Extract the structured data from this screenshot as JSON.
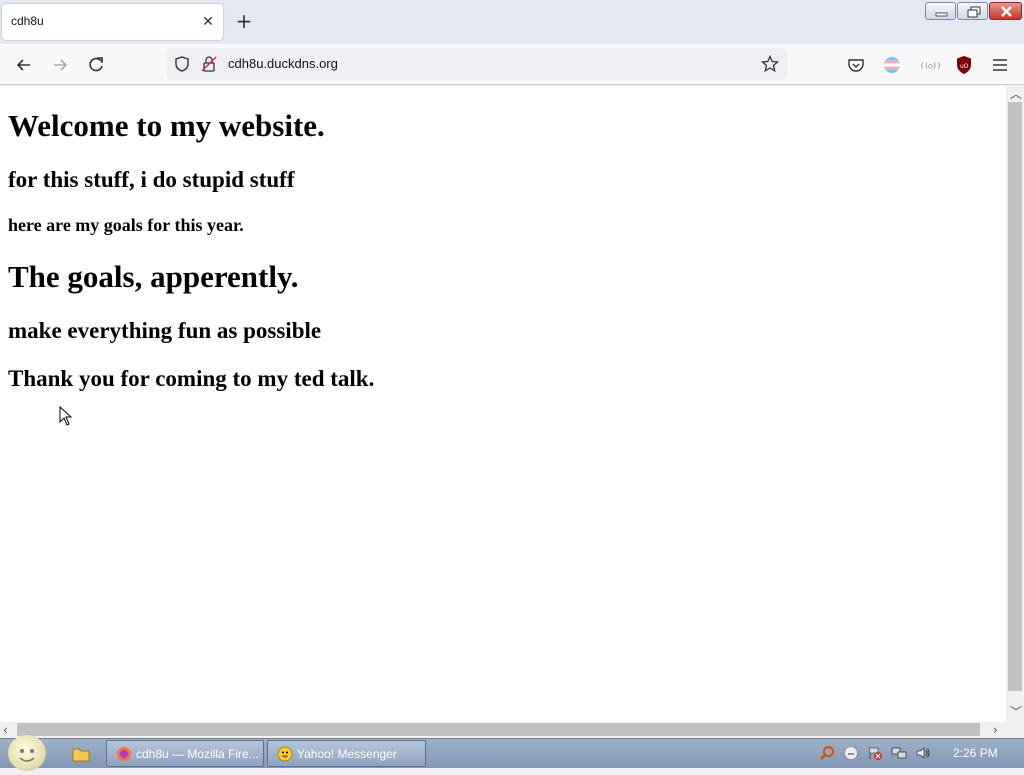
{
  "browser": {
    "tab": {
      "title": "cdh8u",
      "close_glyph": "✕"
    },
    "new_tab_glyph": "+",
    "url": "cdh8u.duckdns.org",
    "icons": [
      "back-icon",
      "forward-icon",
      "reload-icon",
      "shield-icon",
      "lock-insecure-icon",
      "star-icon",
      "pocket-icon",
      "flag-extension-icon",
      "extension-icon",
      "ublock-icon",
      "menu-icon"
    ]
  },
  "page": {
    "heading1": "Welcome to my website.",
    "heading2": "for this stuff, i do stupid stuff",
    "heading3": "here are my goals for this year.",
    "heading4": "The goals, apperently.",
    "heading5": "make everything fun as possible",
    "heading6": "Thank you for coming to my ted talk."
  },
  "taskbar": {
    "tasks": [
      {
        "label": "cdh8u — Mozilla Fire..."
      },
      {
        "label": "Yahoo! Messenger"
      }
    ],
    "clock": "2:26 PM"
  },
  "colors": {
    "accent": "#0061e0",
    "taskbar": "#8aa0bc",
    "ublock": "#800000"
  }
}
